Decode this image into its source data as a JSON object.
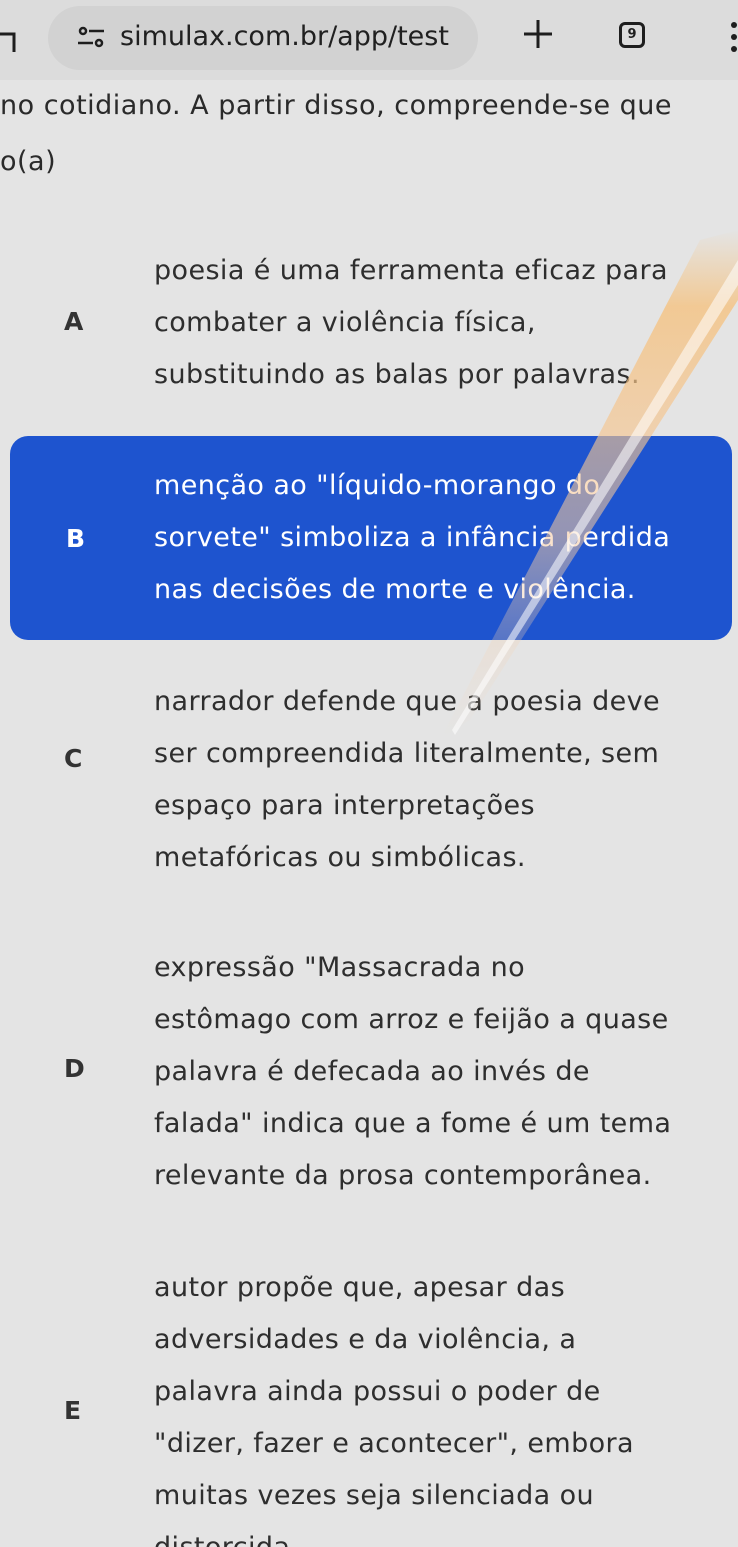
{
  "browser": {
    "url": "simulax.com.br/app/test",
    "tab_count": "9"
  },
  "question": {
    "line1": "no cotidiano. A partir disso, compreende-se que",
    "line2": "o(a)"
  },
  "options": [
    {
      "letter": "A",
      "lines": [
        "poesia é uma ferramenta eficaz para",
        "combater a violência física,",
        "substituindo as balas por palavras."
      ]
    },
    {
      "letter": "B",
      "lines": [
        "menção ao \"líquido-morango do",
        "sorvete\" simboliza a infância perdida",
        "nas decisões de morte e violência."
      ],
      "selected": true
    },
    {
      "letter": "C",
      "lines": [
        "narrador defende que a poesia deve",
        "ser compreendida literalmente, sem",
        "espaço para interpretações",
        "metafóricas ou simbólicas."
      ]
    },
    {
      "letter": "D",
      "lines": [
        "expressão \"Massacrada no",
        "estômago com arroz e feijão a quase",
        "palavra é defecada ao invés de",
        "falada\" indica que a fome é um tema",
        "relevante da prosa contemporânea."
      ]
    },
    {
      "letter": "E",
      "lines": [
        "autor propõe que, apesar das",
        "adversidades e da violência, a",
        "palavra ainda possui o poder de",
        "\"dizer, fazer e acontecer\", embora",
        "muitas vezes seja silenciada ou",
        "distorcida"
      ]
    }
  ],
  "colors": {
    "selected_bg": "#1e54cf",
    "page_bg": "#e4e4e4"
  }
}
